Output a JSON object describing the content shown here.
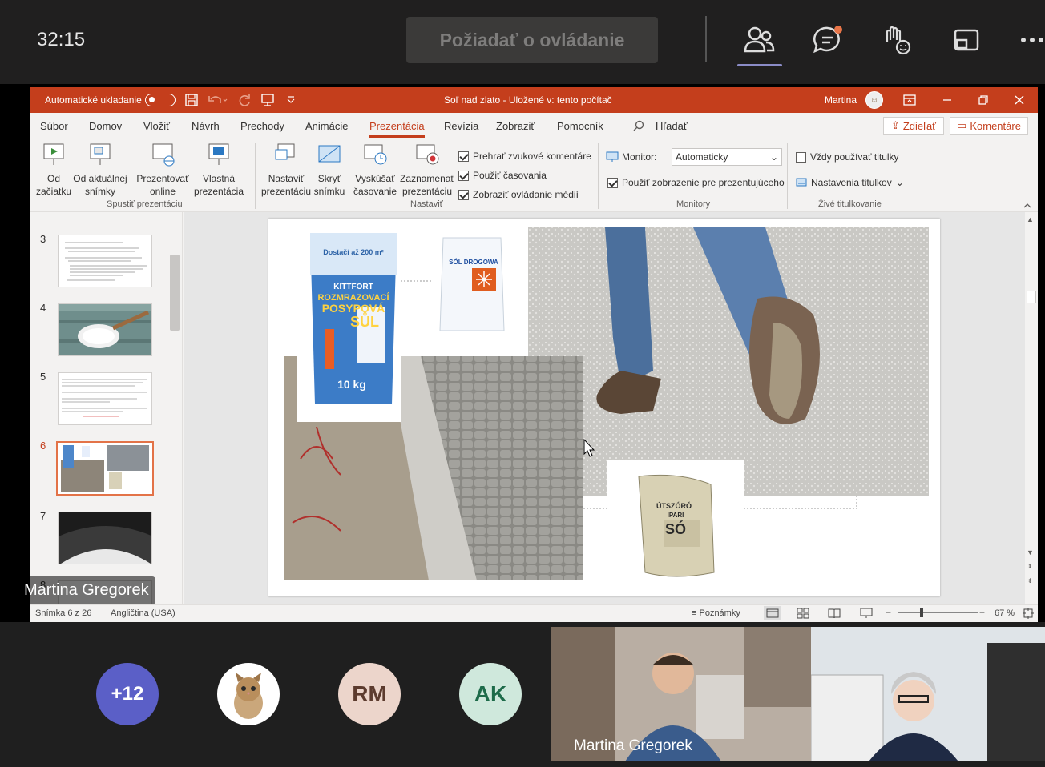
{
  "teams": {
    "timer": "32:15",
    "request_control": "Požiadať o ovládanie",
    "presenter_name": "Martina Gregorek",
    "participants_more": "+12",
    "participant_rm": "RM",
    "participant_ak": "AK",
    "video1_name": "Martina Gregorek",
    "accent_purple": "#5b5fc7"
  },
  "ppt": {
    "autosave_label": "Automatické ukladanie",
    "doc_title": "Soľ nad zlato  -  Uložené v: tento počítač",
    "user": "Martina",
    "search_label": "Hľadať",
    "share_label": "Zdieľať",
    "comments_label": "Komentáre",
    "brand_color": "#c43e1c",
    "tabs": [
      "Súbor",
      "Domov",
      "Vložiť",
      "Návrh",
      "Prechody",
      "Animácie",
      "Prezentácia",
      "Revízia",
      "Zobraziť",
      "Pomocník"
    ],
    "ribbon": {
      "from_start_1": "Od",
      "from_start_2": "začiatku",
      "from_current_1": "Od aktuálnej",
      "from_current_2": "snímky",
      "present_online_1": "Prezentovať",
      "present_online_2": "online",
      "custom_show_1": "Vlastná",
      "custom_show_2": "prezentácia",
      "group_start": "Spustiť prezentáciu",
      "setup_1": "Nastaviť",
      "setup_2": "prezentáciu",
      "hide_1": "Skryť",
      "hide_2": "snímku",
      "rehearse_1": "Vyskúšať",
      "rehearse_2": "časovanie",
      "record_1": "Zaznamenať",
      "record_2": "prezentáciu",
      "chk_narration": "Prehrať zvukové komentáre",
      "chk_timings": "Použiť časovania",
      "chk_media": "Zobraziť ovládanie médií",
      "group_setup": "Nastaviť",
      "monitor_label": "Monitor:",
      "monitor_value": "Automaticky",
      "presenter_view": "Použiť zobrazenie pre prezentujúceho",
      "group_monitors": "Monitory",
      "always_subtitles": "Vždy používať titulky",
      "subtitle_settings": "Nastavenia titulkov",
      "group_captions": "Živé titulkovanie"
    },
    "slides": [
      "3",
      "4",
      "5",
      "6",
      "7",
      "8"
    ],
    "slide_images": {
      "bag1_top": "Dostačí až 200 m²",
      "bag1_brand": "KITTFORT",
      "bag1_line1": "ROZMRAZOVACÍ",
      "bag1_line2": "POSYPOVÁ",
      "bag1_line3": "SŮL",
      "bag1_weight": "10 kg",
      "bag2_title": "SÓL DROGOWA",
      "bag3_title": "ÚTSZÓRÓ",
      "bag3_sub": "IPARI",
      "bag3_main": "SÓ"
    },
    "status": {
      "slide_count": "Snímka 6 z 26",
      "language": "Angličtina (USA)",
      "notes": "Poznámky",
      "zoom": "67 %"
    }
  }
}
